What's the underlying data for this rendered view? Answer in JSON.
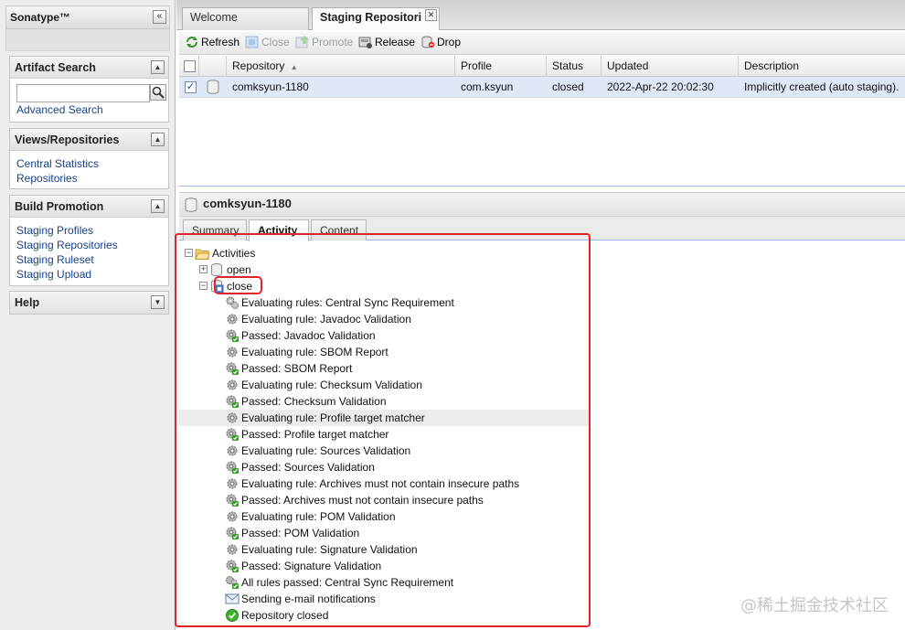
{
  "sidebar": {
    "app_title": "Sonatype™",
    "collapse_glyph": "«",
    "panels": [
      {
        "title": "Artifact Search",
        "search_value": "",
        "links": [
          "Advanced Search"
        ]
      },
      {
        "title": "Views/Repositories",
        "links": [
          "Central Statistics",
          "Repositories"
        ]
      },
      {
        "title": "Build Promotion",
        "links": [
          "Staging Profiles",
          "Staging Repositories",
          "Staging Ruleset",
          "Staging Upload"
        ]
      },
      {
        "title": "Help",
        "links": []
      }
    ]
  },
  "tabs": [
    {
      "label": "Welcome",
      "active": false
    },
    {
      "label": "Staging Repositori",
      "active": true,
      "closable": true
    }
  ],
  "toolbar": {
    "refresh": "Refresh",
    "close": "Close",
    "promote": "Promote",
    "release": "Release",
    "drop": "Drop"
  },
  "grid": {
    "columns": [
      "Repository",
      "Profile",
      "Status",
      "Updated",
      "Description"
    ],
    "sort_indicator": "▲",
    "rows": [
      {
        "repository": "comksyun-1180",
        "profile": "com.ksyun",
        "status": "closed",
        "updated": "2022-Apr-22 20:02:30",
        "description": "Implicitly created (auto staging).",
        "checked": true
      }
    ]
  },
  "detail": {
    "title": "comksyun-1180",
    "subtabs": [
      "Summary",
      "Activity",
      "Content"
    ],
    "active_subtab": "Activity"
  },
  "tree": {
    "root": "Activities",
    "nodes": [
      {
        "label": "open",
        "expanded": false
      },
      {
        "label": "close",
        "expanded": true
      }
    ],
    "events": [
      {
        "text": "Evaluating rules: Central Sync Requirement",
        "icon": "gears-icon"
      },
      {
        "text": "Evaluating rule: Javadoc Validation",
        "icon": "gear-icon"
      },
      {
        "text": "Passed: Javadoc Validation",
        "icon": "gear-pass-icon"
      },
      {
        "text": "Evaluating rule: SBOM Report",
        "icon": "gear-icon"
      },
      {
        "text": "Passed: SBOM Report",
        "icon": "gear-pass-icon"
      },
      {
        "text": "Evaluating rule: Checksum Validation",
        "icon": "gear-icon"
      },
      {
        "text": "Passed: Checksum Validation",
        "icon": "gear-pass-icon"
      },
      {
        "text": "Evaluating rule: Profile target matcher",
        "icon": "gear-icon"
      },
      {
        "text": "Passed: Profile target matcher",
        "icon": "gear-pass-icon"
      },
      {
        "text": "Evaluating rule: Sources Validation",
        "icon": "gear-icon"
      },
      {
        "text": "Passed: Sources Validation",
        "icon": "gear-pass-icon"
      },
      {
        "text": "Evaluating rule: Archives must not contain insecure paths",
        "icon": "gear-icon"
      },
      {
        "text": "Passed: Archives must not contain insecure paths",
        "icon": "gear-pass-icon"
      },
      {
        "text": "Evaluating rule: POM Validation",
        "icon": "gear-icon"
      },
      {
        "text": "Passed: POM Validation",
        "icon": "gear-pass-icon"
      },
      {
        "text": "Evaluating rule: Signature Validation",
        "icon": "gear-icon"
      },
      {
        "text": "Passed: Signature Validation",
        "icon": "gear-pass-icon"
      },
      {
        "text": "All rules passed: Central Sync Requirement",
        "icon": "gears-pass-icon"
      },
      {
        "text": "Sending e-mail notifications",
        "icon": "email-icon"
      },
      {
        "text": "Repository closed",
        "icon": "check-circle-icon"
      }
    ]
  },
  "watermark": "@稀土掘金技术社区",
  "colors": {
    "link": "#15428b",
    "selection": "#dfe8f6",
    "annotation": "#e0242b"
  }
}
